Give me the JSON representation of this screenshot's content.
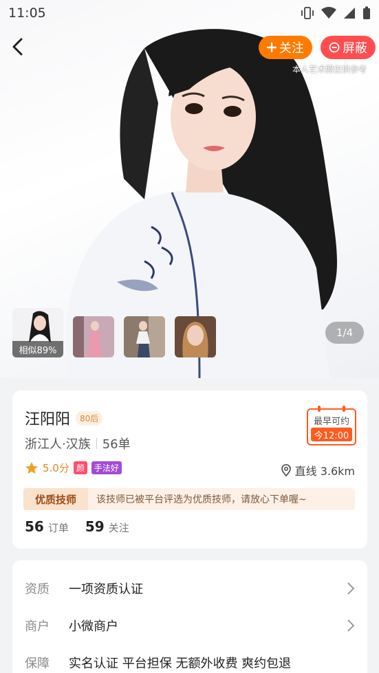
{
  "status_bar": {
    "time": "11:05"
  },
  "hero": {
    "follow_label": "关注",
    "block_label": "屏蔽",
    "disclaimer": "本人艺术照仅供参考",
    "similarity": "相似89%",
    "pager": "1/4"
  },
  "profile": {
    "name": "汪阳阳",
    "age_tag": "80后",
    "origin": "浙江人·汉族",
    "orders_short": "56单",
    "booking_label": "最早可约",
    "booking_time": "今12:00",
    "score": "5.0分",
    "tags": [
      "颜",
      "手法好"
    ],
    "distance": "直线 3.6km",
    "quality_badge": "优质技师",
    "quality_text": "该技师已被平台评选为优质技师，请放心下单喔~",
    "stats": [
      {
        "num": "56",
        "label": "订单"
      },
      {
        "num": "59",
        "label": "关注"
      }
    ]
  },
  "info": [
    {
      "key": "资质",
      "value": "一项资质认证"
    },
    {
      "key": "商户",
      "value": "小微商户"
    },
    {
      "key": "保障",
      "value": "实名认证 平台担保 无额外收费 爽约包退"
    }
  ],
  "colors": {
    "accent_orange": "#ff7a00",
    "block_red": "#ff4d4f",
    "booking_orange": "#ff5a1f"
  },
  "icons": [
    "back-arrow-icon",
    "plus-icon",
    "minus-circle-icon",
    "star-icon",
    "location-pin-icon",
    "chevron-right-icon"
  ]
}
